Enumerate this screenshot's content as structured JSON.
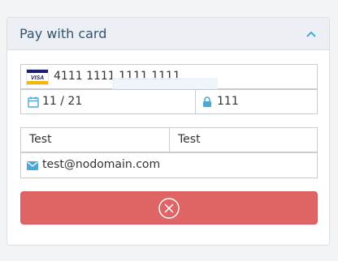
{
  "panel": {
    "title": "Pay with card"
  },
  "card": {
    "brand": "VISA",
    "number": "4111 1111 1111 1111",
    "expiry": "11 / 21",
    "cvc": "111"
  },
  "holder": {
    "first_name": "Test",
    "last_name": "Test",
    "email": "test@nodomain.com"
  },
  "icons": {
    "collapse": "chevron-up-icon",
    "card_brand": "visa-logo-icon",
    "expiry": "calendar-icon",
    "cvc": "lock-icon",
    "email": "envelope-icon",
    "submit": "circle-x-icon"
  },
  "colors": {
    "accent": "#4aa8d8",
    "submit_button": "#df6466",
    "title": "#35536e"
  }
}
